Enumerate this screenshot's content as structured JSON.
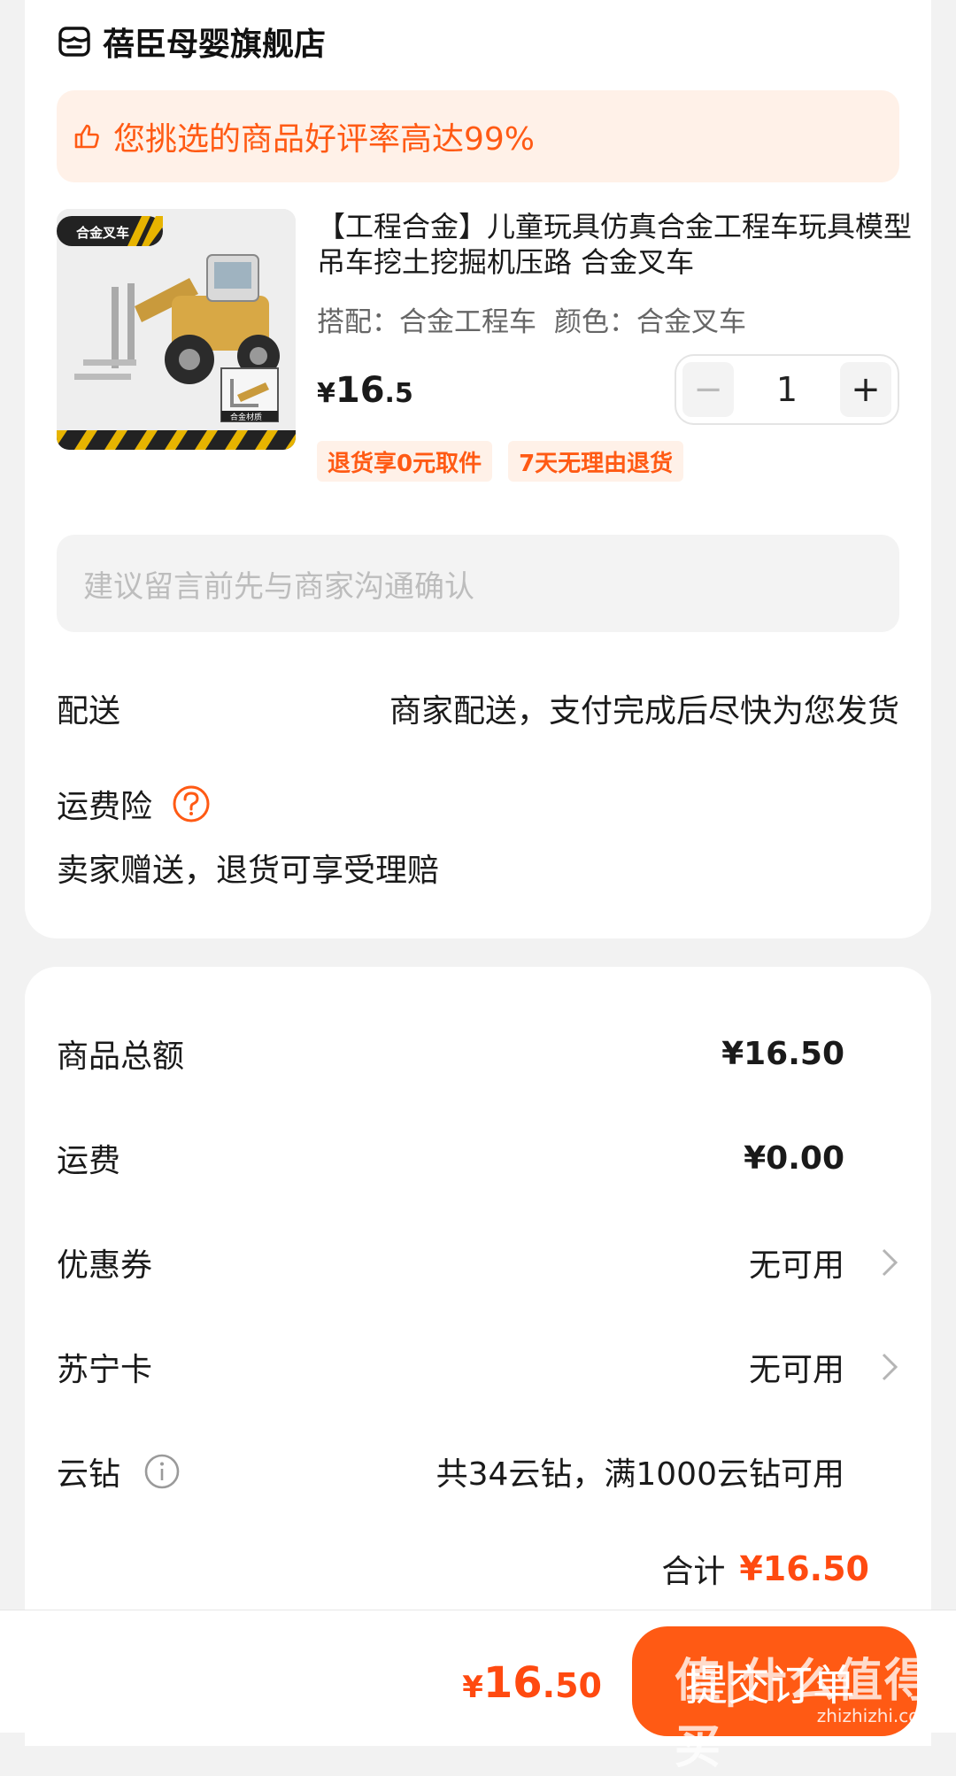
{
  "store": {
    "name": "蓓臣母婴旗舰店",
    "icon": "store-icon"
  },
  "banner": {
    "text": "您挑选的商品好评率高达99%",
    "icon": "thumb-up-icon"
  },
  "product": {
    "image_tags": {
      "top": "合金叉车",
      "bottom": "合金材质"
    },
    "title": "【工程合金】儿童玩具仿真合金工程车玩具模型吊车挖土挖掘机压路 合金叉车",
    "spec_match": "搭配：合金工程车",
    "spec_color": "颜色：合金叉车",
    "price": {
      "symbol": "¥",
      "integer": "16",
      "decimal": ".5"
    },
    "quantity": "1",
    "badges": [
      "退货享0元取件",
      "7天无理由退货"
    ]
  },
  "note": {
    "placeholder": "建议留言前先与商家沟通确认"
  },
  "delivery": {
    "label": "配送",
    "value": "商家配送，支付完成后尽快为您发货"
  },
  "insurance": {
    "label": "运费险",
    "desc": "卖家赠送，退货可享受理赔",
    "icon": "question-icon"
  },
  "summary": {
    "goods_total": {
      "label": "商品总额",
      "value": "¥16.50"
    },
    "shipping": {
      "label": "运费",
      "value": "¥0.00"
    },
    "coupon": {
      "label": "优惠券",
      "value": "无可用"
    },
    "suning_card": {
      "label": "苏宁卡",
      "value": "无可用"
    },
    "yunzuan": {
      "label": "云钻",
      "value": "共34云钻，满1000云钻可用"
    },
    "total_label": "合计",
    "total_value": "¥16.50"
  },
  "bottom_bar": {
    "price": {
      "symbol": "¥",
      "integer": "16",
      "decimal": ".50"
    },
    "submit_label": "提交订单"
  },
  "watermark": {
    "main": "值|什么值得买",
    "sub": "zhizhizhi.com"
  },
  "colors": {
    "accent": "#ff5a14",
    "price_red": "#ff4a10",
    "banner_bg": "#fff1e8"
  }
}
